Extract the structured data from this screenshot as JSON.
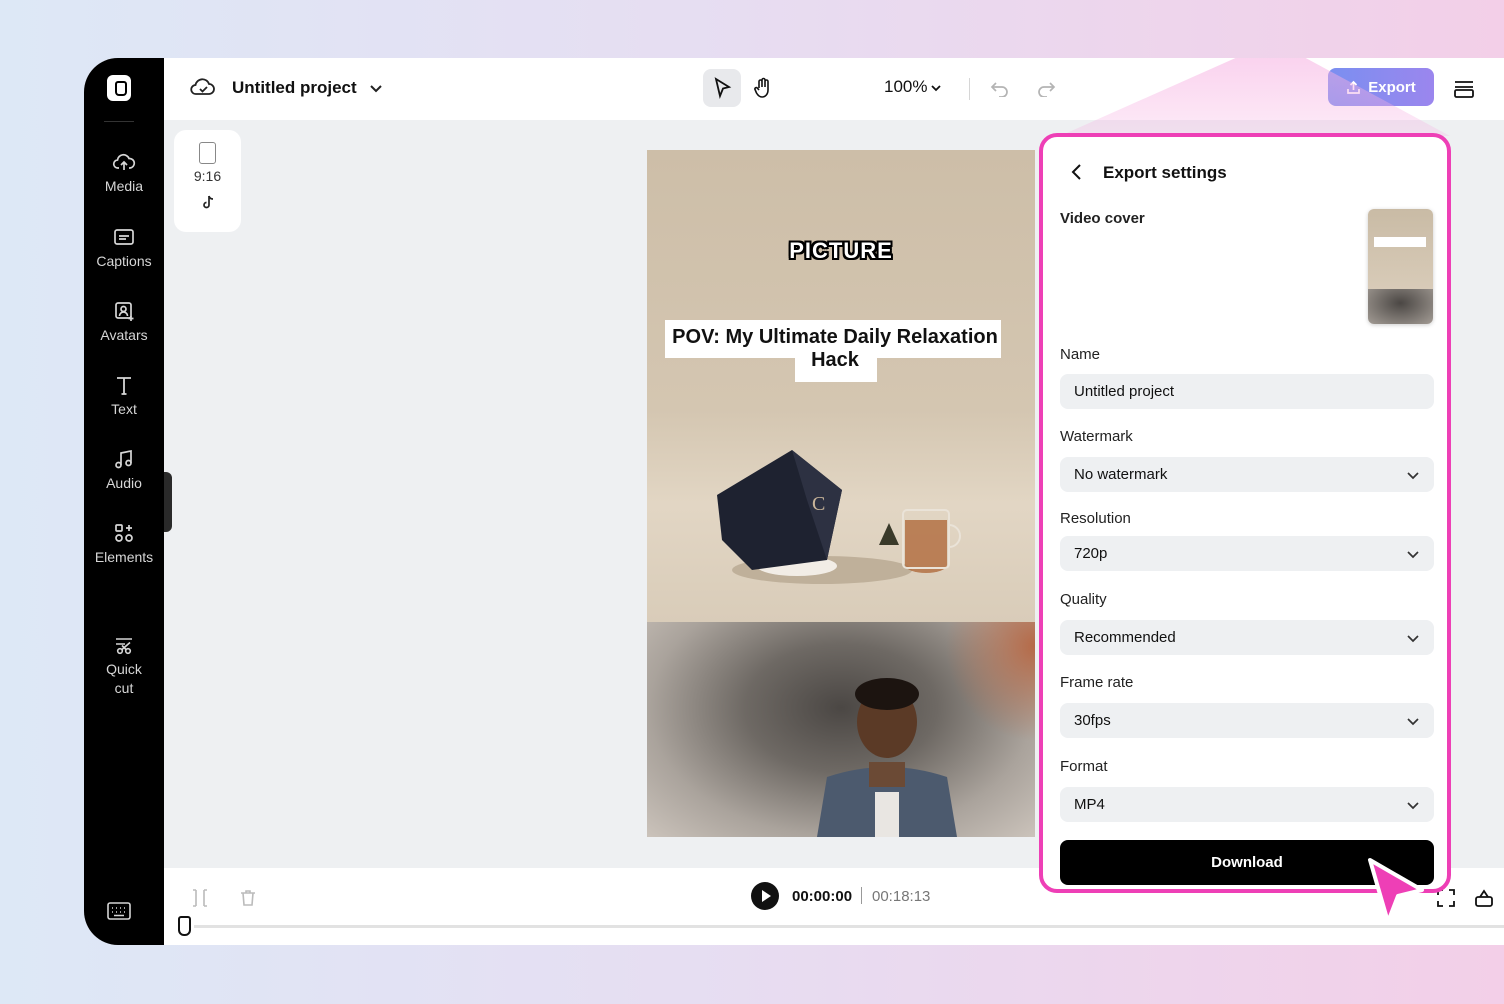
{
  "topbar": {
    "project_title": "Untitled project",
    "zoom": "100%",
    "export_label": "Export"
  },
  "sidebar": {
    "items": [
      {
        "label": "Media",
        "icon": "cloud-upload-icon"
      },
      {
        "label": "Captions",
        "icon": "captions-icon"
      },
      {
        "label": "Avatars",
        "icon": "avatar-icon"
      },
      {
        "label": "Text",
        "icon": "text-icon"
      },
      {
        "label": "Audio",
        "icon": "music-note-icon"
      },
      {
        "label": "Elements",
        "icon": "elements-icon"
      },
      {
        "label": "Quick\ncut",
        "icon": "scissors-icon"
      }
    ]
  },
  "canvas": {
    "aspect_ratio": "9:16",
    "video_title": "PICTURE",
    "caption": "POV: My Ultimate Daily Relaxation Hack"
  },
  "playback": {
    "current_time": "00:00:00",
    "total_time": "00:18:13"
  },
  "export_panel": {
    "title": "Export settings",
    "video_cover_label": "Video cover",
    "name_label": "Name",
    "name_value": "Untitled project",
    "watermark_label": "Watermark",
    "watermark_value": "No watermark",
    "resolution_label": "Resolution",
    "resolution_value": "720p",
    "quality_label": "Quality",
    "quality_value": "Recommended",
    "framerate_label": "Frame rate",
    "framerate_value": "30fps",
    "format_label": "Format",
    "format_value": "MP4",
    "download_label": "Download"
  },
  "colors": {
    "accent_pink": "#ee3fb6",
    "export_button": "#8a8cef",
    "sidebar_bg": "#000000"
  }
}
